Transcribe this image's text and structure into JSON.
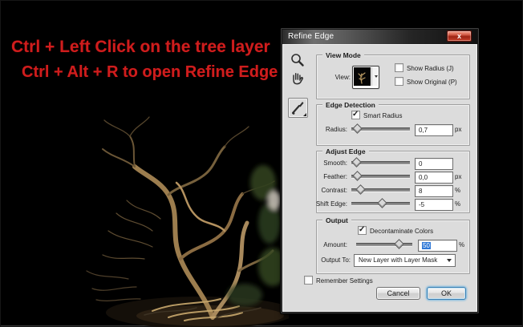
{
  "instructions": {
    "line1": "Ctrl + Left Click on the tree layer",
    "line2": "Ctrl + Alt + R to open Refine Edge",
    "text_color": "#cf1d1d"
  },
  "dialog": {
    "title": "Refine Edge",
    "close_label": "x",
    "view_mode": {
      "group_title": "View Mode",
      "view_label": "View:",
      "show_radius": {
        "label": "Show Radius (J)",
        "checked": false
      },
      "show_original": {
        "label": "Show Original (P)",
        "checked": false
      }
    },
    "edge_detection": {
      "group_title": "Edge Detection",
      "smart_radius": {
        "label": "Smart Radius",
        "checked": true
      },
      "radius": {
        "label": "Radius:",
        "value": "0,7",
        "unit": "px",
        "slider_percent": 4
      }
    },
    "adjust_edge": {
      "group_title": "Adjust Edge",
      "rows": [
        {
          "label": "Smooth:",
          "value": "0",
          "unit": "",
          "slider_percent": 3
        },
        {
          "label": "Feather:",
          "value": "0,0",
          "unit": "px",
          "slider_percent": 4
        },
        {
          "label": "Contrast:",
          "value": "8",
          "unit": "%",
          "slider_percent": 10
        },
        {
          "label": "Shift Edge:",
          "value": "-5",
          "unit": "%",
          "slider_percent": 46
        }
      ]
    },
    "output": {
      "group_title": "Output",
      "decontaminate": {
        "label": "Decontaminate Colors",
        "checked": true
      },
      "amount": {
        "label": "Amount:",
        "value": "50",
        "unit": "%",
        "slider_percent": 70,
        "value_selected": true
      },
      "output_to": {
        "label": "Output To:",
        "value": "New Layer with Layer Mask"
      }
    },
    "remember_settings": {
      "label": "Remember Settings",
      "checked": false
    },
    "buttons": {
      "cancel": "Cancel",
      "ok": "OK"
    },
    "colors": {
      "dialog_bg": "#dcdcdc",
      "titlebar_dark": "#262626",
      "close_red": "#c6402a",
      "selection_blue": "#2f78d6",
      "ok_glow": "#7ab8e0"
    }
  }
}
